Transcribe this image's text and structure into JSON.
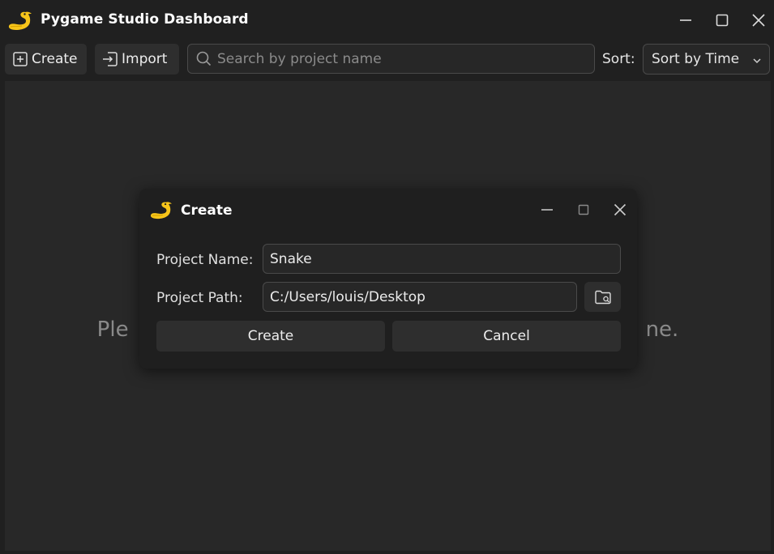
{
  "window": {
    "title": "Pygame Studio Dashboard",
    "logo_icon": "pygame-snake-icon"
  },
  "toolbar": {
    "create_label": "Create",
    "import_label": "Import",
    "search_placeholder": "Search by project name",
    "search_value": "",
    "sort_label": "Sort:",
    "sort_selected": "Sort by Time"
  },
  "main": {
    "empty_message_left": "Ple",
    "empty_message_right": "ne."
  },
  "dialog": {
    "title": "Create",
    "project_name_label": "Project Name:",
    "project_name_value": "Snake",
    "project_path_label": "Project Path:",
    "project_path_value": "C:/Users/louis/Desktop",
    "create_button": "Create",
    "cancel_button": "Cancel"
  },
  "colors": {
    "background": "#202020",
    "panel": "#282828",
    "dialog": "#1f1f1f",
    "button": "#2e2e2e",
    "border": "#4a4a4a",
    "logo_yellow": "#f7c51a"
  }
}
